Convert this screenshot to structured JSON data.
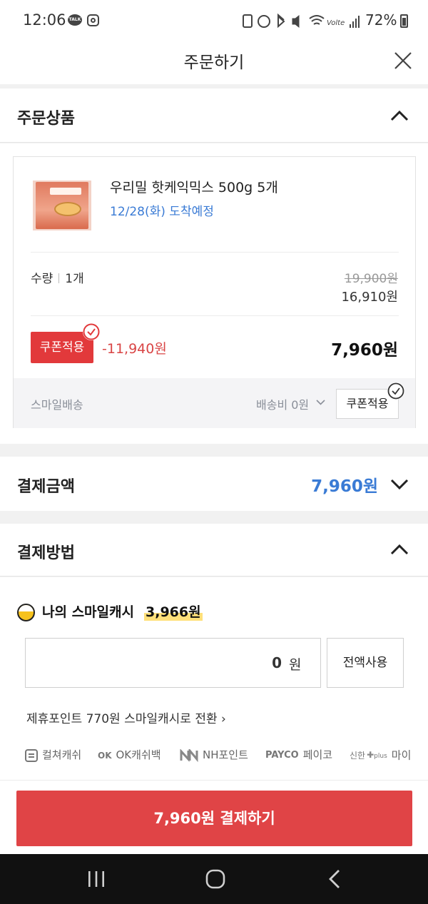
{
  "status_bar": {
    "time": "12:06",
    "talk_label": "TALK",
    "battery": "72%"
  },
  "header": {
    "title": "주문하기"
  },
  "order_section": {
    "title": "주문상품",
    "product": {
      "name": "우리밀 핫케익믹스 500g 5개",
      "delivery": "12/28(화) 도착예정",
      "qty_label": "수량",
      "qty_value": "1개",
      "original_price": "19,900원",
      "sale_price": "16,910원",
      "coupon_label": "쿠폰적용",
      "discount": "-11,940원",
      "final_price": "7,960원"
    },
    "shipping": {
      "label": "스마일배송",
      "fee": "배송비 0원",
      "coupon_label": "쿠폰적용"
    }
  },
  "payment_amount": {
    "title": "결제금액",
    "amount": "7,960원"
  },
  "payment_method": {
    "title": "결제방법",
    "cash_label": "나의 스마일캐시",
    "cash_balance": "3,966원",
    "input_value": "0",
    "input_unit": "원",
    "full_use_label": "전액사용",
    "convert_link": "제휴포인트 770원 스마일캐시로 전환 ›",
    "partners": [
      {
        "label": "컬쳐캐쉬"
      },
      {
        "label": "OK캐쉬백"
      },
      {
        "label": "NH포인트"
      },
      {
        "label": "페이코"
      },
      {
        "label": "마이"
      }
    ],
    "partner_logos": {
      "ok": "OK",
      "payco": "PAYCO",
      "shinhan": "신한",
      "plus": "plus"
    }
  },
  "pay_button": {
    "label": "7,960원 결제하기"
  },
  "colors": {
    "accent_red": "#e04446",
    "price_blue": "#3a7bd5",
    "discount_red": "#d94545",
    "cash_yellow": "#f6c21c"
  }
}
